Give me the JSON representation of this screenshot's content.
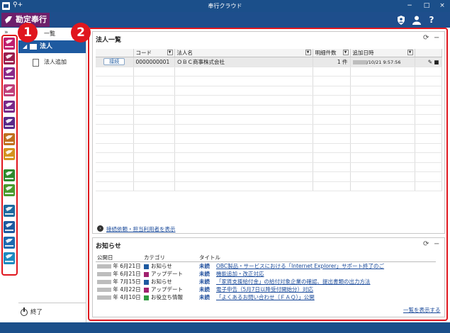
{
  "window": {
    "title": "奉行クラウド",
    "search_glyph": "⚲+",
    "minimize": "−",
    "maximize": "□",
    "close": "×"
  },
  "header": {
    "logo_text": "勘定奉行",
    "icons": [
      "shield-user-icon",
      "user-icon",
      "help-icon"
    ],
    "help_glyph": "?"
  },
  "sidebar": {
    "collapse_glyph": "»",
    "tree_header": "一覧",
    "selected_label": "法人",
    "items": [
      {
        "label": "法人追加"
      }
    ],
    "logout_label": "終了",
    "module_colors": [
      "#c01e6e",
      "#9b1e4e",
      "#8a2a8a",
      "#c0407a",
      "#7a2a8a",
      "#5a2a8a",
      "#c0701e",
      "#d4921e",
      "#2e8a2e",
      "#4a9a2e",
      "#1e6aa0",
      "#1e5aa0",
      "#1e6ab0",
      "#1e8ac0"
    ]
  },
  "annotations": {
    "badge1": "1",
    "badge2": "2"
  },
  "corp_panel": {
    "title": "法人一覧",
    "columns": [
      "コード",
      "法人名",
      "明細件数",
      "追加日時"
    ],
    "rows": [
      {
        "button": "接続",
        "code": "0000000001",
        "name": "ＯＢＣ商事株式会社",
        "count": "1 件",
        "added": "/10/21 9:57:56"
      }
    ],
    "footer_link": "接続依頼・担当利用者を表示"
  },
  "news_panel": {
    "title": "お知らせ",
    "columns": [
      "公開日",
      "カテゴリ",
      "タイトル"
    ],
    "rows": [
      {
        "date": "年  6月21日",
        "category": "お知らせ",
        "category_color": "#1e5aa0",
        "status": "未読",
        "title": "OBC製品・サービスにおける「Internet Explorer」サポート終了のご"
      },
      {
        "date": "年  6月21日",
        "category": "アップデート",
        "category_color": "#a0206e",
        "status": "未読",
        "title": "機能追加・改正対応"
      },
      {
        "date": "年  7月15日",
        "category": "お知らせ",
        "category_color": "#1e5aa0",
        "status": "未読",
        "title": "「家賃支援給付金」の給付対象企業の確認、提出書類の出力方法"
      },
      {
        "date": "年  4月22日",
        "category": "アップデート",
        "category_color": "#a0206e",
        "status": "未読",
        "title": "電子申告（5月7日以降受付開始分）対応"
      },
      {
        "date": "年  4月10日",
        "category": "お役立ち情報",
        "category_color": "#2e9a3e",
        "status": "未読",
        "title": "「よくあるお問い合わせ（ＦＡＱ）」公開"
      }
    ],
    "more_link": "一覧を表示する"
  }
}
